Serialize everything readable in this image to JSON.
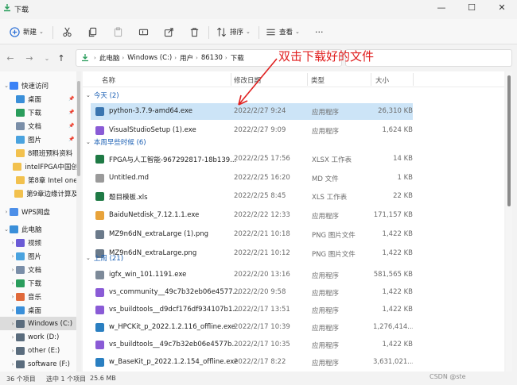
{
  "window": {
    "title": "下载",
    "minimize": "—",
    "maximize": "☐",
    "close": "✕"
  },
  "toolbar": {
    "new_label": "新建",
    "sort_label": "排序",
    "view_label": "查看",
    "more_label": "···"
  },
  "address": {
    "crumbs": [
      "此电脑",
      "Windows (C:)",
      "用户",
      "86130",
      "下载"
    ]
  },
  "annotation": {
    "text": "双击下载好的文件",
    "color": "#e02020"
  },
  "nav": {
    "items": [
      {
        "label": "快速访问",
        "level": 0,
        "icon": "star-icon",
        "color": "#3b82f6",
        "chevron": "v"
      },
      {
        "label": "桌面",
        "level": 1,
        "icon": "desktop-icon",
        "color": "#3a8fd9",
        "pinned": true
      },
      {
        "label": "下载",
        "level": 1,
        "icon": "download-icon",
        "color": "#2a9d5c",
        "pinned": true
      },
      {
        "label": "文档",
        "level": 1,
        "icon": "document-icon",
        "color": "#7a8ea8",
        "pinned": true
      },
      {
        "label": "图片",
        "level": 1,
        "icon": "picture-icon",
        "color": "#4aa3df",
        "pinned": true
      },
      {
        "label": "8眼班预料资料",
        "level": 1,
        "icon": "folder-icon",
        "color": "#f2c14e"
      },
      {
        "label": "intelFPGA中国创",
        "level": 1,
        "icon": "folder-icon",
        "color": "#f2c14e"
      },
      {
        "label": "第8章 Intel one",
        "level": 1,
        "icon": "folder-icon",
        "color": "#f2c14e"
      },
      {
        "label": "第9章边缘计算及",
        "level": 1,
        "icon": "folder-icon",
        "color": "#f2c14e"
      },
      {
        "label": "WPS网盘",
        "level": 0,
        "icon": "cloud-icon",
        "color": "#4d8fe8",
        "chevron": ">"
      },
      {
        "label": "此电脑",
        "level": 0,
        "icon": "computer-icon",
        "color": "#3a8fd9",
        "chevron": "v"
      },
      {
        "label": "视频",
        "level": 1,
        "icon": "video-icon",
        "color": "#6b5bd6",
        "chevron": ">"
      },
      {
        "label": "图片",
        "level": 1,
        "icon": "picture-icon",
        "color": "#4aa3df",
        "chevron": ">"
      },
      {
        "label": "文档",
        "level": 1,
        "icon": "document-icon",
        "color": "#7a8ea8",
        "chevron": ">"
      },
      {
        "label": "下载",
        "level": 1,
        "icon": "download-icon",
        "color": "#2a9d5c",
        "chevron": ">"
      },
      {
        "label": "音乐",
        "level": 1,
        "icon": "music-icon",
        "color": "#e0693a",
        "chevron": ">"
      },
      {
        "label": "桌面",
        "level": 1,
        "icon": "desktop-icon",
        "color": "#3a8fd9",
        "chevron": ">"
      },
      {
        "label": "Windows (C:)",
        "level": 1,
        "icon": "drive-icon",
        "color": "#5a6c7d",
        "chevron": ">",
        "selected": true
      },
      {
        "label": "work (D:)",
        "level": 1,
        "icon": "drive-icon",
        "color": "#5a6c7d",
        "chevron": ">"
      },
      {
        "label": "other (E:)",
        "level": 1,
        "icon": "drive-icon",
        "color": "#5a6c7d",
        "chevron": ">"
      },
      {
        "label": "software (F:)",
        "level": 1,
        "icon": "drive-icon",
        "color": "#5a6c7d",
        "chevron": ">"
      }
    ]
  },
  "columns": {
    "name": "名称",
    "date": "修改日期",
    "type": "类型",
    "size": "大小"
  },
  "groups": [
    {
      "label": "今天 (2)",
      "files": [
        {
          "name": "python-3.7.9-amd64.exe",
          "date": "2022/2/27 9:24",
          "type": "应用程序",
          "size": "26,310 KB",
          "icon": "python-installer-icon",
          "color": "#3a75b0",
          "selected": true
        },
        {
          "name": "VisualStudioSetup (1).exe",
          "date": "2022/2/27 9:09",
          "type": "应用程序",
          "size": "1,624 KB",
          "icon": "visual-studio-icon",
          "color": "#8a5bd6"
        }
      ]
    },
    {
      "label": "本周早些时候 (6)",
      "files": [
        {
          "name": "FPGA与人工智能-967292817-18b139...",
          "date": "2022/2/25 17:56",
          "type": "XLSX 工作表",
          "size": "14 KB",
          "icon": "excel-icon",
          "color": "#1f7a45"
        },
        {
          "name": "Untitled.md",
          "date": "2022/2/25 16:20",
          "type": "MD 文件",
          "size": "1 KB",
          "icon": "markdown-file-icon",
          "color": "#9a9a9a"
        },
        {
          "name": "题目模板.xls",
          "date": "2022/2/25 8:45",
          "type": "XLS 工作表",
          "size": "22 KB",
          "icon": "excel-icon",
          "color": "#1f7a45"
        },
        {
          "name": "BaiduNetdisk_7.12.1.1.exe",
          "date": "2022/2/22 12:33",
          "type": "应用程序",
          "size": "171,157 KB",
          "icon": "baidu-netdisk-icon",
          "color": "#e8a33a"
        },
        {
          "name": "MZ9n6dN_extraLarge (1).png",
          "date": "2022/2/21 10:18",
          "type": "PNG 图片文件",
          "size": "1,422 KB",
          "icon": "image-file-icon",
          "color": "#6b7a8a"
        },
        {
          "name": "MZ9n6dN_extraLarge.png",
          "date": "2022/2/21 10:12",
          "type": "PNG 图片文件",
          "size": "1,422 KB",
          "icon": "image-file-icon",
          "color": "#6b7a8a"
        }
      ]
    },
    {
      "label": "上周 (21)",
      "files": [
        {
          "name": "igfx_win_101.1191.exe",
          "date": "2022/2/20 13:16",
          "type": "应用程序",
          "size": "581,565 KB",
          "icon": "installer-icon",
          "color": "#7d8a99"
        },
        {
          "name": "vs_community__49c7b32eb06e4577...",
          "date": "2022/2/20 9:58",
          "type": "应用程序",
          "size": "1,422 KB",
          "icon": "visual-studio-icon",
          "color": "#8a5bd6"
        },
        {
          "name": "vs_buildtools__d9dcf176df934107b1...",
          "date": "2022/2/17 13:51",
          "type": "应用程序",
          "size": "1,422 KB",
          "icon": "visual-studio-icon",
          "color": "#8a5bd6"
        },
        {
          "name": "w_HPCKit_p_2022.1.2.116_offline.exe",
          "date": "2022/2/17 10:39",
          "type": "应用程序",
          "size": "1,276,414...",
          "icon": "intel-installer-icon",
          "color": "#2a7fc1"
        },
        {
          "name": "vs_buildtools__49c7b32eb06e4577b...",
          "date": "2022/2/17 10:35",
          "type": "应用程序",
          "size": "1,422 KB",
          "icon": "visual-studio-icon",
          "color": "#8a5bd6"
        },
        {
          "name": "w_BaseKit_p_2022.1.2.154_offline.exe",
          "date": "2022/2/17 8:22",
          "type": "应用程序",
          "size": "3,631,021...",
          "icon": "intel-installer-icon",
          "color": "#2a7fc1"
        }
      ]
    }
  ],
  "status": {
    "count": "36 个项目",
    "selected": "选中 1 个项目",
    "size": "25.6 MB"
  },
  "watermark": "CSDN @ste"
}
